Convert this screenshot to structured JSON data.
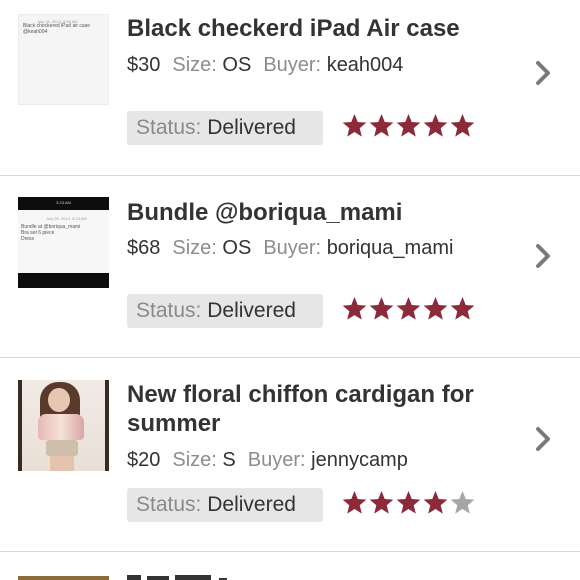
{
  "listings": [
    {
      "title": "Black checkerd iPad Air case",
      "price": "$30",
      "size_label": "Size:",
      "size": "OS",
      "buyer_label": "Buyer:",
      "buyer": "keah004",
      "status_label": "Status:",
      "status": "Delivered",
      "rating": 5,
      "rating_max": 5,
      "thumb_meta": "July 25, 2014, 8:58 AM",
      "thumb_text": [
        "Black checkered iPad air case",
        "@keah004"
      ]
    },
    {
      "title": "Bundle @boriqua_mami",
      "price": "$68",
      "size_label": "Size:",
      "size": "OS",
      "buyer_label": "Buyer:",
      "buyer": "boriqua_mami",
      "status_label": "Status:",
      "status": "Delivered",
      "rating": 5,
      "rating_max": 5,
      "thumb_time": "3:23 AM",
      "thumb_meta": "July 25, 2014, 3:23 AM",
      "thumb_text": [
        "Bundle at @boriqua_mami",
        "Bra set 6 piece",
        "Dress"
      ]
    },
    {
      "title_lines": [
        "New floral chiffon cardigan for",
        "summer"
      ],
      "price": "$20",
      "size_label": "Size:",
      "size": "S",
      "buyer_label": "Buyer:",
      "buyer": "jennycamp",
      "status_label": "Status:",
      "status": "Delivered",
      "rating": 4,
      "rating_max": 5
    }
  ],
  "colors": {
    "star_filled": "#8c2a3a",
    "star_empty": "#a6a6a6",
    "chevron": "#7a7a7a"
  },
  "icons": {
    "star": "star-icon",
    "chevron": "chevron-right-icon"
  }
}
